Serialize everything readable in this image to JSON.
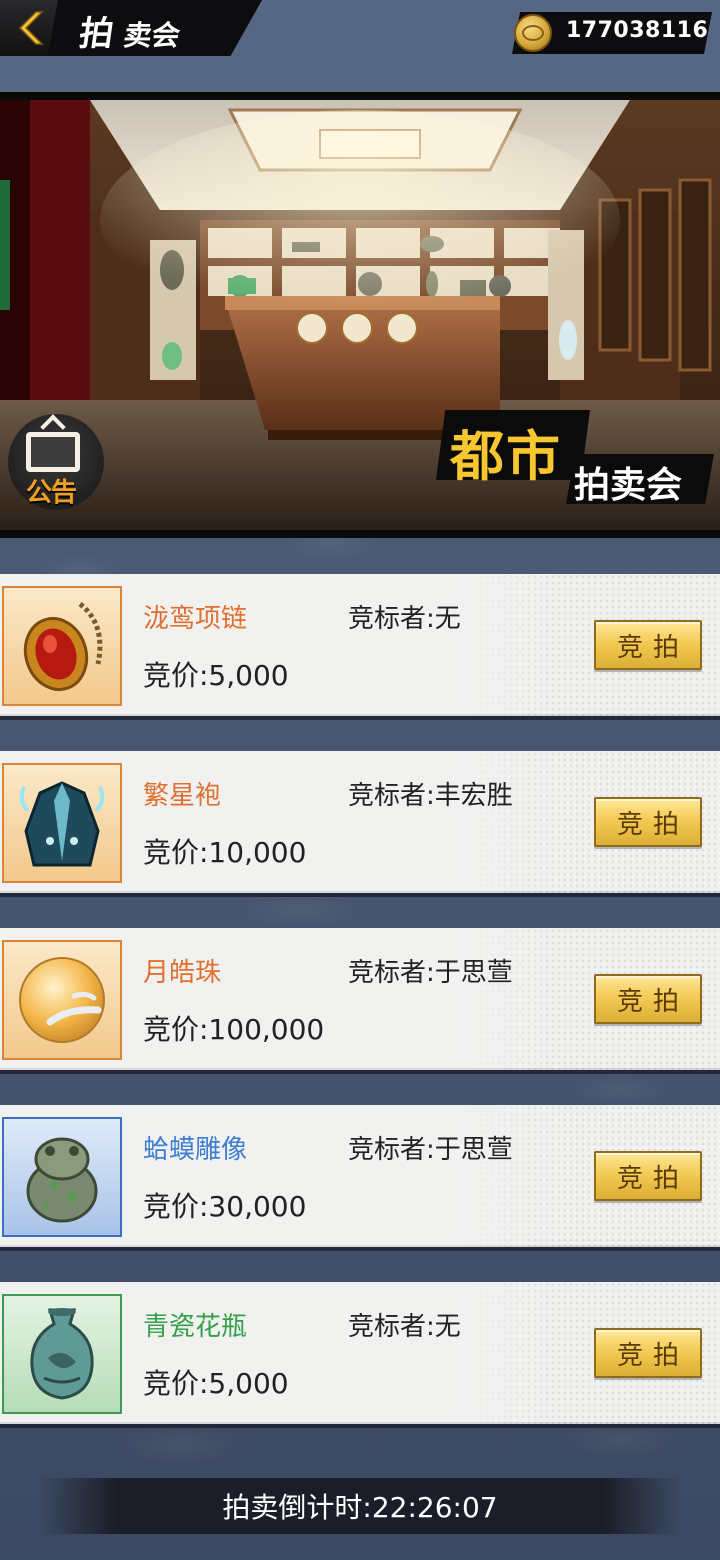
{
  "header": {
    "title_big": "拍",
    "title_small": "卖会",
    "coins": "177038116"
  },
  "banner": {
    "notice_label": "公告",
    "logo_line1": "都市",
    "logo_line2": "拍卖会"
  },
  "items": [
    {
      "name": "泷鸾项链",
      "name_color": "orange",
      "bidder": "竞标者:无",
      "price": "竞价:5,000",
      "bid_label": "竞拍",
      "icon": "necklace-icon"
    },
    {
      "name": "繁星袍",
      "name_color": "orange",
      "bidder": "竞标者:丰宏胜",
      "price": "竞价:10,000",
      "bid_label": "竞拍",
      "icon": "robe-icon"
    },
    {
      "name": "月皓珠",
      "name_color": "orange",
      "bidder": "竞标者:于思萱",
      "price": "竞价:100,000",
      "bid_label": "竞拍",
      "icon": "pearl-icon"
    },
    {
      "name": "蛤蟆雕像",
      "name_color": "blue",
      "bidder": "竞标者:于思萱",
      "price": "竞价:30,000",
      "bid_label": "竞拍",
      "icon": "toad-statue-icon"
    },
    {
      "name": "青瓷花瓶",
      "name_color": "green",
      "bidder": "竞标者:无",
      "price": "竞价:5,000",
      "bid_label": "竞拍",
      "icon": "vase-icon"
    }
  ],
  "footer": {
    "countdown": "拍卖倒计时:22:26:07"
  },
  "colors": {
    "accent_gold": "#f3cb55",
    "name_orange": "#e07030",
    "name_blue": "#3d7fd0",
    "name_green": "#33a04a",
    "background": "#4a5a74"
  }
}
